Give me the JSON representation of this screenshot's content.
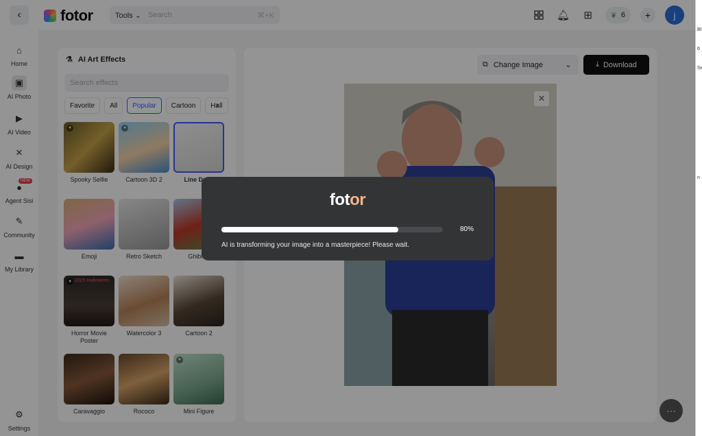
{
  "header": {
    "back_icon": "chevron-left-icon",
    "brand": "fotor",
    "tools_label": "Tools",
    "search_placeholder": "Search",
    "shortcut": "⌘+K",
    "credits": "6",
    "avatar_initial": "j",
    "icons": [
      "grid-icon",
      "bell-icon",
      "gift-icon",
      "leaf-icon",
      "plus-icon"
    ]
  },
  "sidebar": {
    "items": [
      {
        "label": "Home",
        "icon": "home-icon"
      },
      {
        "label": "AI Photo",
        "icon": "ai-photo-icon"
      },
      {
        "label": "AI Video",
        "icon": "ai-video-icon"
      },
      {
        "label": "AI Design",
        "icon": "ai-design-icon"
      },
      {
        "label": "Agent Sisi",
        "icon": "agent-icon",
        "badge": "NEW"
      },
      {
        "label": "Community",
        "icon": "community-icon"
      },
      {
        "label": "My Library",
        "icon": "folder-icon"
      }
    ],
    "settings": "Settings"
  },
  "panel": {
    "title": "AI Art Effects",
    "search_placeholder": "Search effects",
    "chips": [
      "Favorite",
      "All",
      "Popular",
      "Cartoon",
      "Hall"
    ],
    "active_chip": "Popular",
    "effects": [
      {
        "label": "Spooky Selfie"
      },
      {
        "label": "Cartoon 3D 2"
      },
      {
        "label": "Line Draw"
      },
      {
        "label": "Emoji"
      },
      {
        "label": "Retro Sketch"
      },
      {
        "label": "Ghibli S"
      },
      {
        "label": "Horror Movie Poster",
        "overlay_text": "2025 Halloween"
      },
      {
        "label": "Watercolor 3"
      },
      {
        "label": "Cartoon 2"
      },
      {
        "label": "Caravaggio"
      },
      {
        "label": "Rococo"
      },
      {
        "label": "Mini Figure"
      }
    ]
  },
  "canvas": {
    "change_image": "Change Image",
    "download": "Download"
  },
  "modal": {
    "brand_prefix": "f",
    "brand_mid": "ot",
    "brand_accent": "or",
    "progress": 80,
    "progress_label": "80%",
    "message": "AI is transforming your image into a masterpiece! Please wait."
  },
  "right_strip": [
    "Bl",
    "6",
    "Se",
    "n"
  ]
}
